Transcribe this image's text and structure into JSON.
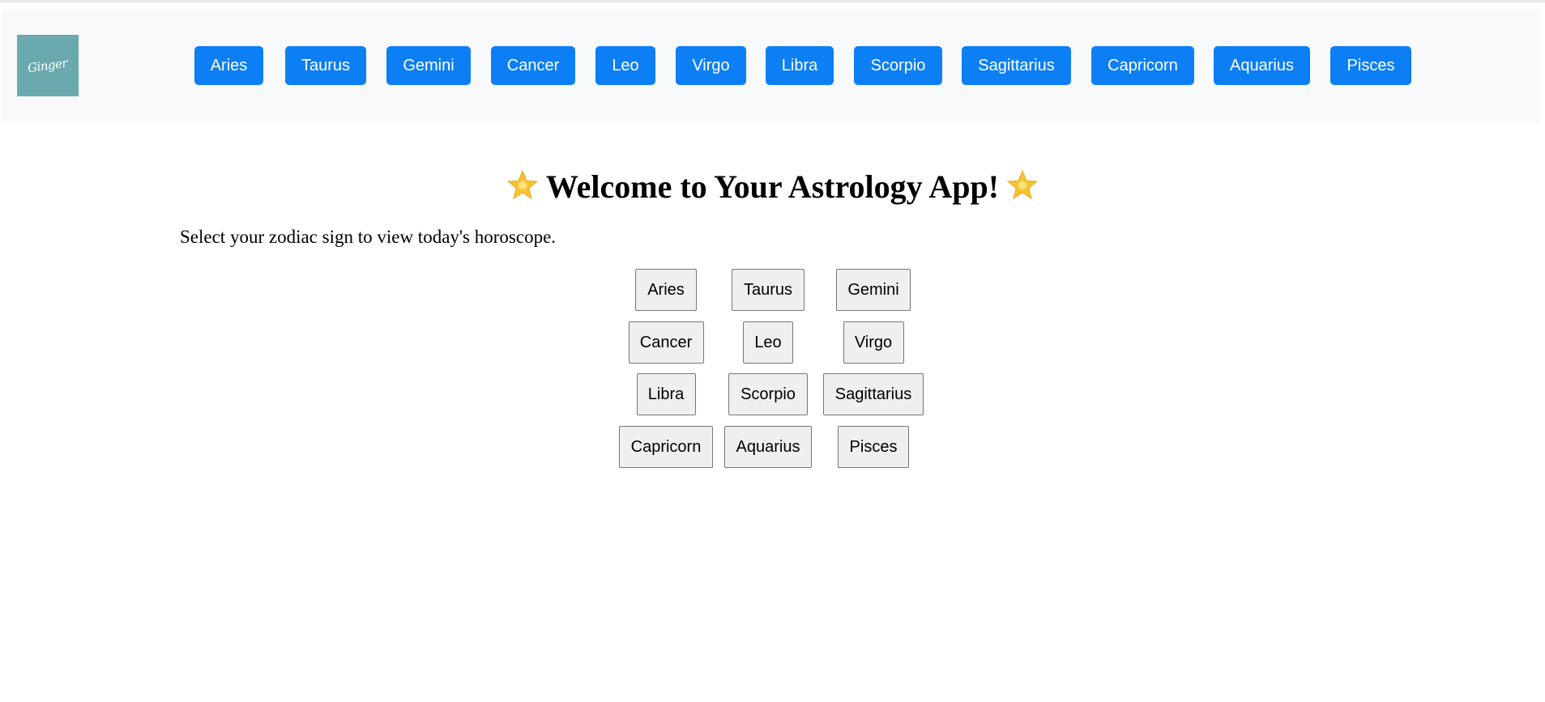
{
  "header": {
    "logo_text": "Ginger",
    "nav_items": [
      "Aries",
      "Taurus",
      "Gemini",
      "Cancer",
      "Leo",
      "Virgo",
      "Libra",
      "Scorpio",
      "Sagittarius",
      "Capricorn",
      "Aquarius",
      "Pisces"
    ]
  },
  "main": {
    "title": "Welcome to Your Astrology App!",
    "title_icon": "glowing-star-icon",
    "subtitle": "Select your zodiac sign to view today's horoscope.",
    "sign_rows": [
      [
        "Aries",
        "Taurus",
        "Gemini"
      ],
      [
        "Cancer",
        "Leo",
        "Virgo"
      ],
      [
        "Libra",
        "Scorpio",
        "Sagittarius"
      ],
      [
        "Capricorn",
        "Aquarius",
        "Pisces"
      ]
    ]
  },
  "colors": {
    "nav_button_bg": "#0d7ff5",
    "navbar_bg": "#f8f9fa",
    "logo_bg": "#6aa9ae",
    "star_yellow": "#f7c331"
  }
}
